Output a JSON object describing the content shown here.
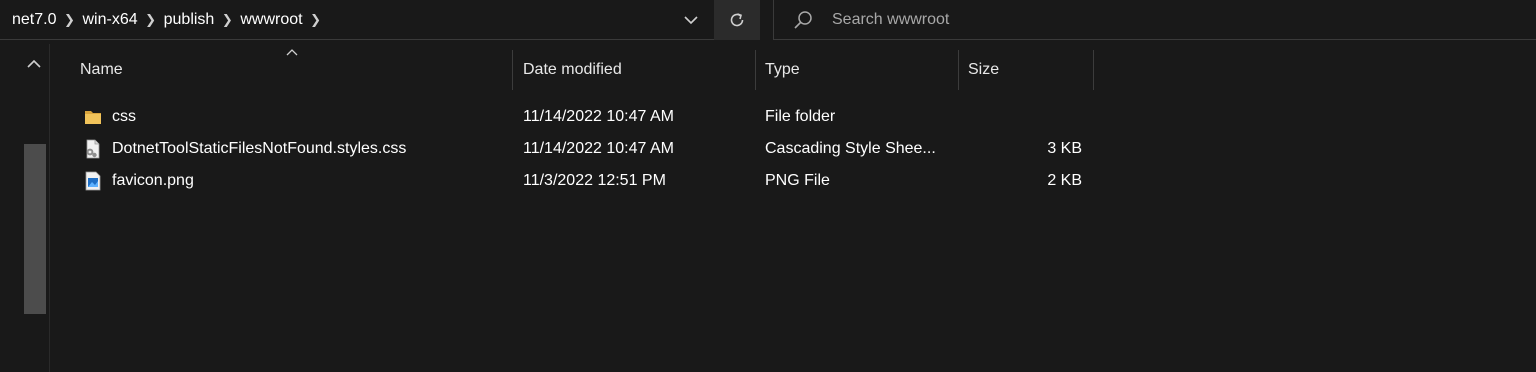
{
  "breadcrumb": {
    "items": [
      {
        "label": "net7.0"
      },
      {
        "label": "win-x64"
      },
      {
        "label": "publish"
      },
      {
        "label": "wwwroot"
      }
    ],
    "separator": "❯"
  },
  "address_bar": {
    "dropdown_icon": "chevron-down-icon",
    "refresh_icon": "refresh-icon"
  },
  "search": {
    "placeholder": "Search wwwroot",
    "value": ""
  },
  "columns": [
    {
      "label": "Name"
    },
    {
      "label": "Date modified"
    },
    {
      "label": "Type"
    },
    {
      "label": "Size"
    }
  ],
  "files": [
    {
      "name": "css",
      "date": "11/14/2022 10:47 AM",
      "type": "File folder",
      "size": "",
      "icon": "folder-icon"
    },
    {
      "name": "DotnetToolStaticFilesNotFound.styles.css",
      "date": "11/14/2022 10:47 AM",
      "type": "Cascading Style Shee...",
      "size": "3 KB",
      "icon": "css-file-icon"
    },
    {
      "name": "favicon.png",
      "date": "11/3/2022 12:51 PM",
      "type": "PNG File",
      "size": "2 KB",
      "icon": "image-file-icon"
    }
  ],
  "colors": {
    "background": "#191919",
    "folder": "#e8b64c",
    "text": "#ffffff"
  }
}
